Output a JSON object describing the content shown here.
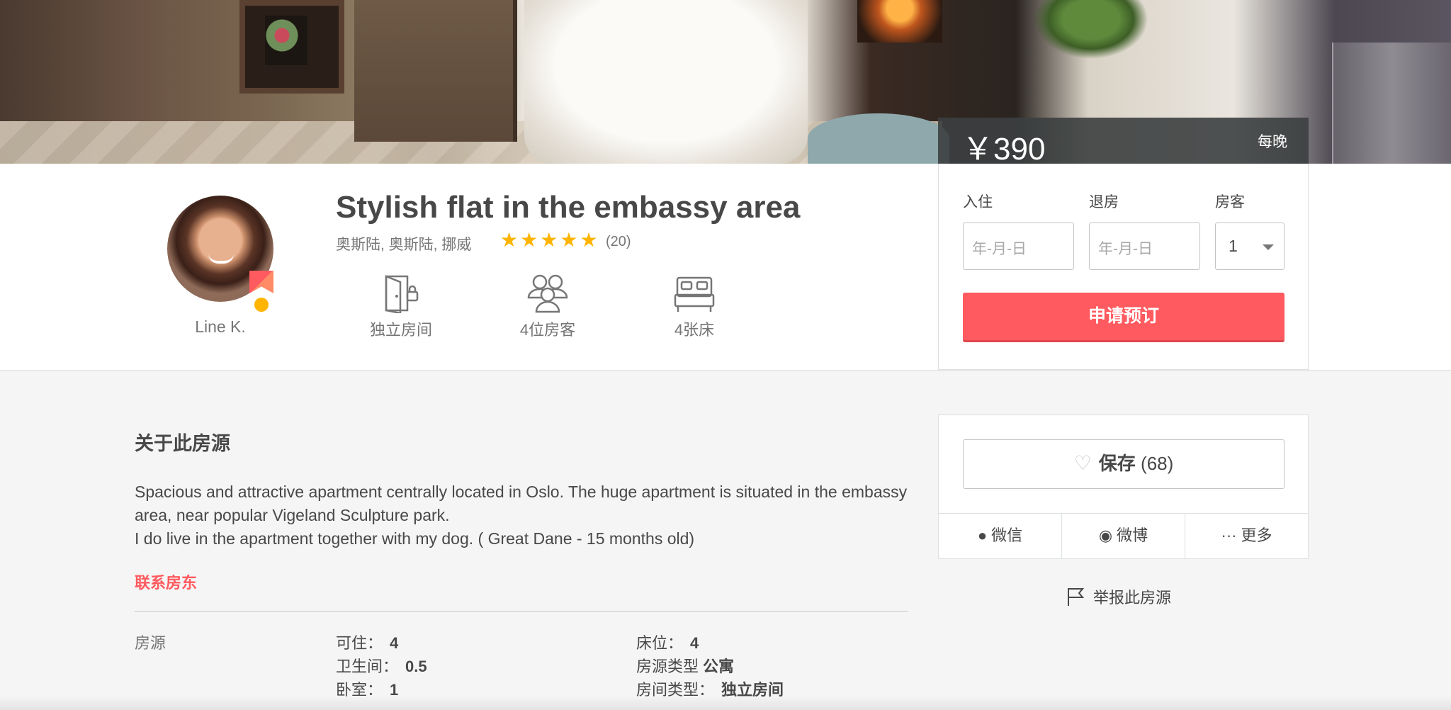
{
  "listing": {
    "price": "￥390",
    "per_night": "每晚",
    "title": "Stylish flat in the embassy area",
    "location": "奥斯陆, 奥斯陆, 挪威",
    "rating": 5,
    "review_count": "(20)",
    "host_name": "Line K."
  },
  "features": [
    {
      "label": "独立房间",
      "icon": "private-room-icon"
    },
    {
      "label": "4位房客",
      "icon": "guests-icon"
    },
    {
      "label": "4张床",
      "icon": "bed-icon"
    }
  ],
  "booking": {
    "checkin_label": "入住",
    "checkout_label": "退房",
    "guests_label": "房客",
    "checkin_placeholder": "年-月-日",
    "checkout_placeholder": "年-月-日",
    "guests_value": "1",
    "request_button": "申请预订"
  },
  "about": {
    "heading": "关于此房源",
    "description": [
      "Spacious and attractive apartment centrally located in Oslo. The huge apartment is situated in the embassy area, near popular Vigeland Sculpture park.",
      "I do live in the apartment together with my dog. ( Great Dane - 15 months old)"
    ],
    "contact_link": "联系房东"
  },
  "specs": {
    "heading": "房源",
    "accommodates_label": "可住：",
    "accommodates_value": "4",
    "bathrooms_label": "卫生间：",
    "bathrooms_value": "0.5",
    "bedrooms_label": "卧室：",
    "bedrooms_value": "1",
    "beds_label": "床位：",
    "beds_value": "4",
    "property_type_label": "房源类型",
    "property_type_value": "公寓",
    "room_type_label": "房间类型：",
    "room_type_value": "独立房间"
  },
  "save": {
    "save_label": "保存",
    "save_count": "(68)",
    "share_wechat": "微信",
    "share_weibo": "微博",
    "share_more": "更多",
    "report": "举报此房源"
  },
  "colors": {
    "accent": "#ff5a5f",
    "star": "#ffb400",
    "text": "#484848",
    "muted": "#767676"
  }
}
